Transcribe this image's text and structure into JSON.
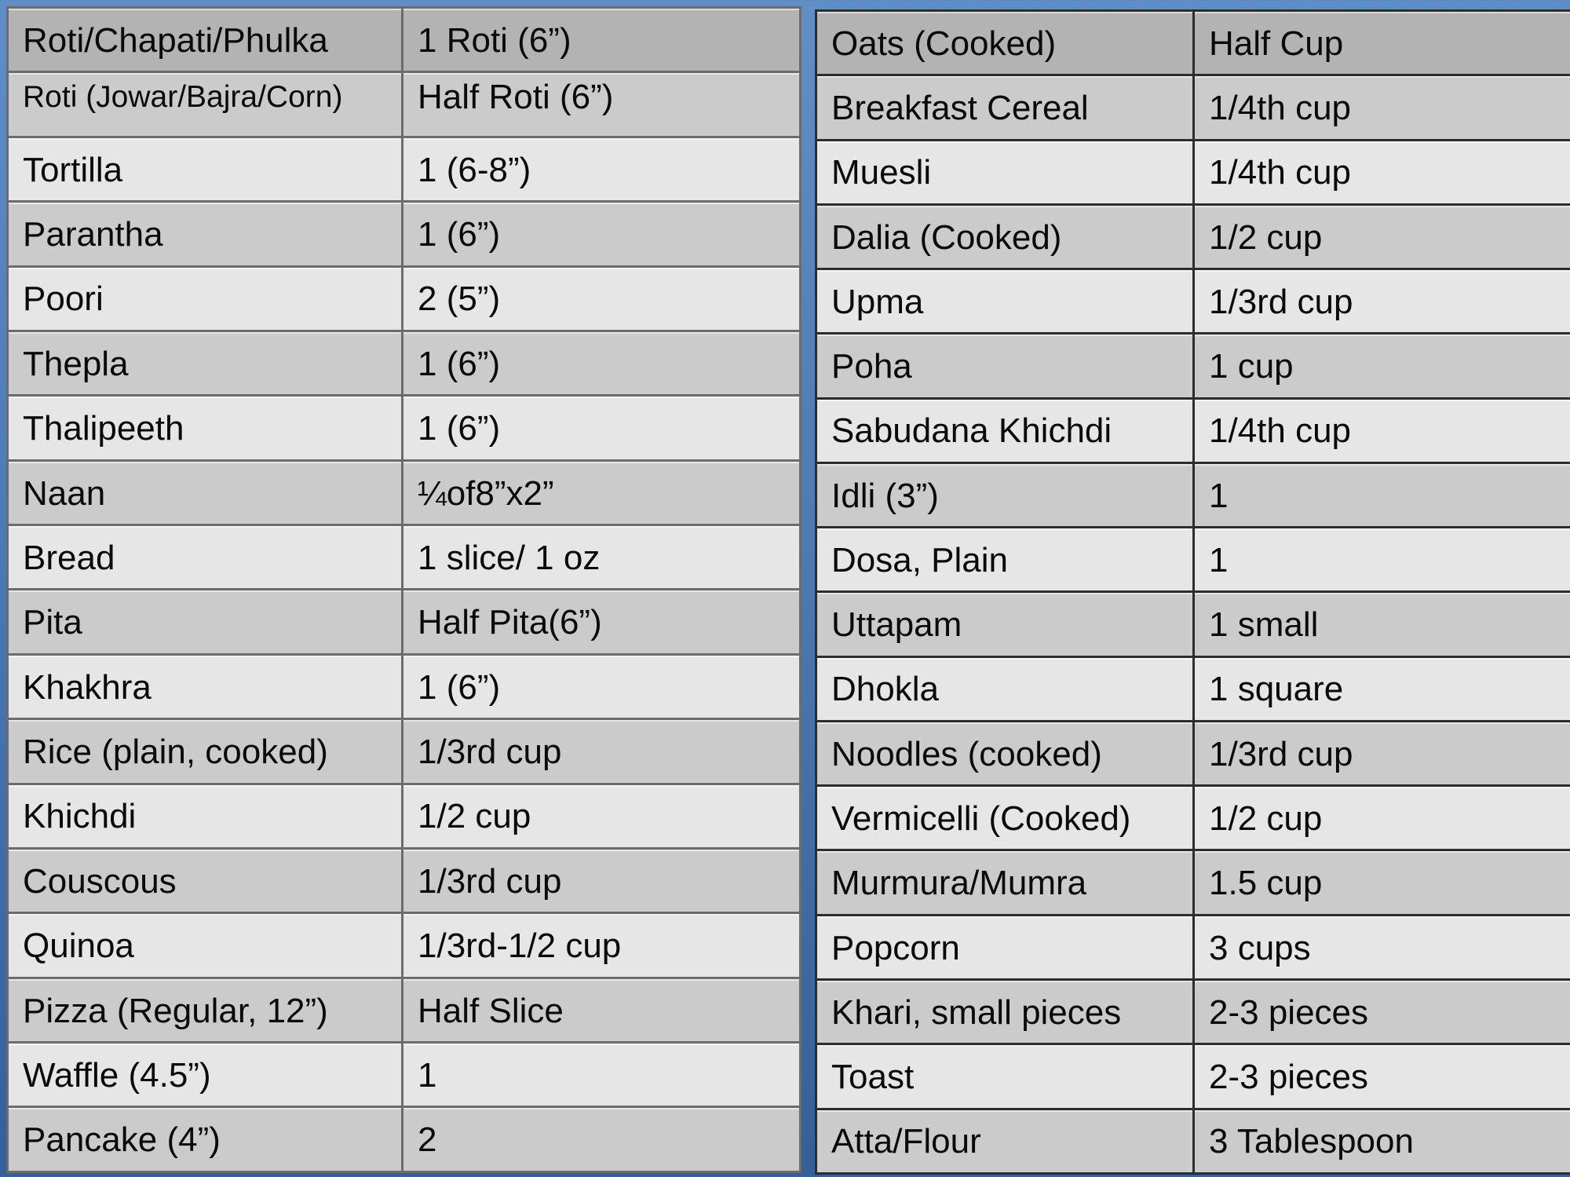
{
  "left_table": {
    "rows": [
      {
        "food": "Roti/Chapati/Phulka",
        "portion": "1 Roti (6”)"
      },
      {
        "food": "Roti (Jowar/Bajra/Corn)",
        "portion": "Half Roti (6”)"
      },
      {
        "food": "Tortilla",
        "portion": "1 (6-8”)"
      },
      {
        "food": "Parantha",
        "portion": "1 (6”)"
      },
      {
        "food": "Poori",
        "portion": "2 (5”)"
      },
      {
        "food": "Thepla",
        "portion": "1 (6”)"
      },
      {
        "food": "Thalipeeth",
        "portion": "1 (6”)"
      },
      {
        "food": "Naan",
        "portion": "¼of8”x2”"
      },
      {
        "food": "Bread",
        "portion": "1 slice/ 1 oz"
      },
      {
        "food": "Pita",
        "portion": "Half Pita(6”)"
      },
      {
        "food": "Khakhra",
        "portion": "1 (6”)"
      },
      {
        "food": "Rice (plain, cooked)",
        "portion": "1/3rd cup"
      },
      {
        "food": "Khichdi",
        "portion": "1/2 cup"
      },
      {
        "food": "Couscous",
        "portion": "1/3rd cup"
      },
      {
        "food": "Quinoa",
        "portion": "1/3rd-1/2 cup"
      },
      {
        "food": "Pizza (Regular, 12”)",
        "portion": "Half Slice"
      },
      {
        "food": "Waffle (4.5”)",
        "portion": "1"
      },
      {
        "food": "Pancake (4”)",
        "portion": "2"
      }
    ]
  },
  "right_table": {
    "rows": [
      {
        "food": "Oats (Cooked)",
        "portion": "Half Cup"
      },
      {
        "food": "Breakfast Cereal",
        "portion": "1/4th cup"
      },
      {
        "food": "Muesli",
        "portion": "1/4th cup"
      },
      {
        "food": "Dalia (Cooked)",
        "portion": "1/2 cup"
      },
      {
        "food": "Upma",
        "portion": "1/3rd cup"
      },
      {
        "food": "Poha",
        "portion": "1 cup"
      },
      {
        "food": "Sabudana Khichdi",
        "portion": "1/4th cup"
      },
      {
        "food": "Idli (3”)",
        "portion": "1"
      },
      {
        "food": "Dosa, Plain",
        "portion": "1"
      },
      {
        "food": "Uttapam",
        "portion": "1 small"
      },
      {
        "food": "Dhokla",
        "portion": "1 square"
      },
      {
        "food": "Noodles (cooked)",
        "portion": "1/3rd cup"
      },
      {
        "food": "Vermicelli (Cooked)",
        "portion": "1/2 cup"
      },
      {
        "food": "Murmura/Mumra",
        "portion": "1.5 cup"
      },
      {
        "food": "Popcorn",
        "portion": "3 cups"
      },
      {
        "food": "Khari, small pieces",
        "portion": "2-3 pieces"
      },
      {
        "food": "Toast",
        "portion": "2-3 pieces"
      },
      {
        "food": "Atta/Flour",
        "portion": "3 Tablespoon"
      }
    ]
  },
  "colors": {
    "background": "#4a78b0",
    "header_row": "#b3b3b3",
    "row_dark": "#cbcbcb",
    "row_light": "#e6e6e6",
    "text": "#0a0a0a"
  }
}
